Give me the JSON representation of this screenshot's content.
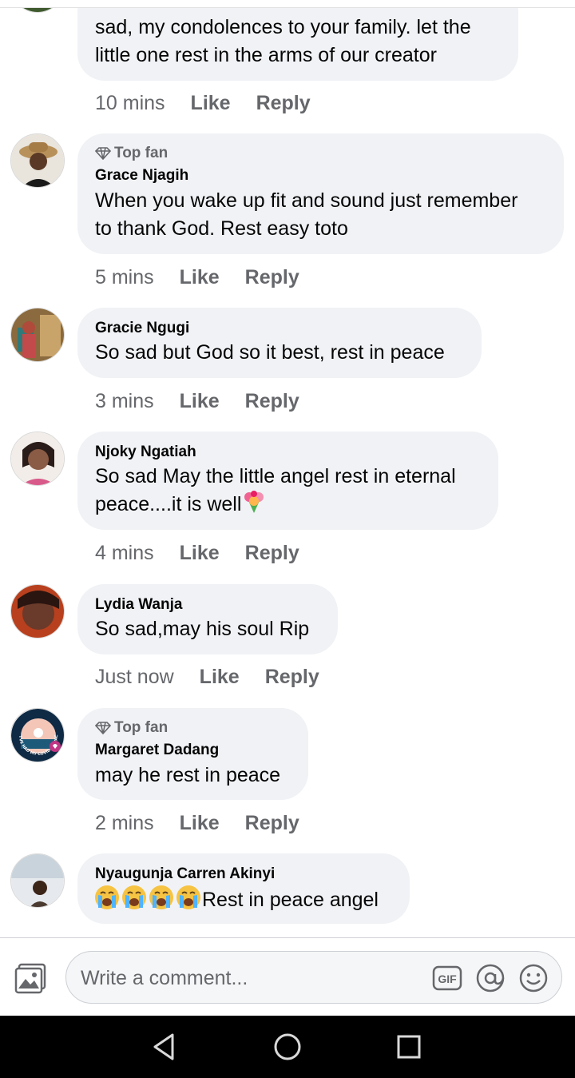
{
  "comments": [
    {
      "text_lines": [
        "sad, my condolences to your family. let the",
        "little one rest in the arms of our creator"
      ],
      "time": "10 mins",
      "like": "Like",
      "reply": "Reply"
    },
    {
      "badge": "Top fan",
      "author": "Grace Njagih",
      "text_lines": [
        "When you wake up fit and sound just remember",
        "to thank God. Rest easy toto"
      ],
      "time": "5 mins",
      "like": "Like",
      "reply": "Reply"
    },
    {
      "author": "Gracie Ngugi",
      "text_lines": [
        "So sad but God so it best, rest in peace"
      ],
      "time": "3 mins",
      "like": "Like",
      "reply": "Reply"
    },
    {
      "author": "Njoky Ngatiah",
      "text_lines": [
        "So sad May the little angel rest in eternal",
        "peace....it is well"
      ],
      "trailing_emoji": "bouquet",
      "time": "4 mins",
      "like": "Like",
      "reply": "Reply"
    },
    {
      "author": "Lydia Wanja",
      "text_lines": [
        "So sad,may his soul Rip"
      ],
      "time": "Just now",
      "like": "Like",
      "reply": "Reply"
    },
    {
      "badge": "Top fan",
      "author": "Margaret Dadang",
      "text_lines": [
        "may he rest in peace"
      ],
      "avatar_frame_text": "I'VE HAD MY COVID-19 VACCINE",
      "time": "2 mins",
      "like": "Like",
      "reply": "Reply"
    },
    {
      "author": "Nyaugunja Carren Akinyi",
      "leading_emojis": [
        "loudly-crying-face",
        "loudly-crying-face",
        "loudly-crying-face",
        "loudly-crying-face"
      ],
      "text_lines": [
        "Rest in peace angel"
      ]
    }
  ],
  "composer": {
    "placeholder": "Write a comment...",
    "gif_label": "GIF",
    "icons": [
      "photo-icon",
      "gif-icon",
      "mention-icon",
      "emoji-icon"
    ]
  },
  "navigation": {
    "icons": [
      "back-icon",
      "home-icon",
      "recents-icon"
    ]
  },
  "colors": {
    "bubble": "#f0f2f5",
    "meta_text": "#65676b",
    "body_text": "#050505",
    "nav_bar": "#000000"
  }
}
